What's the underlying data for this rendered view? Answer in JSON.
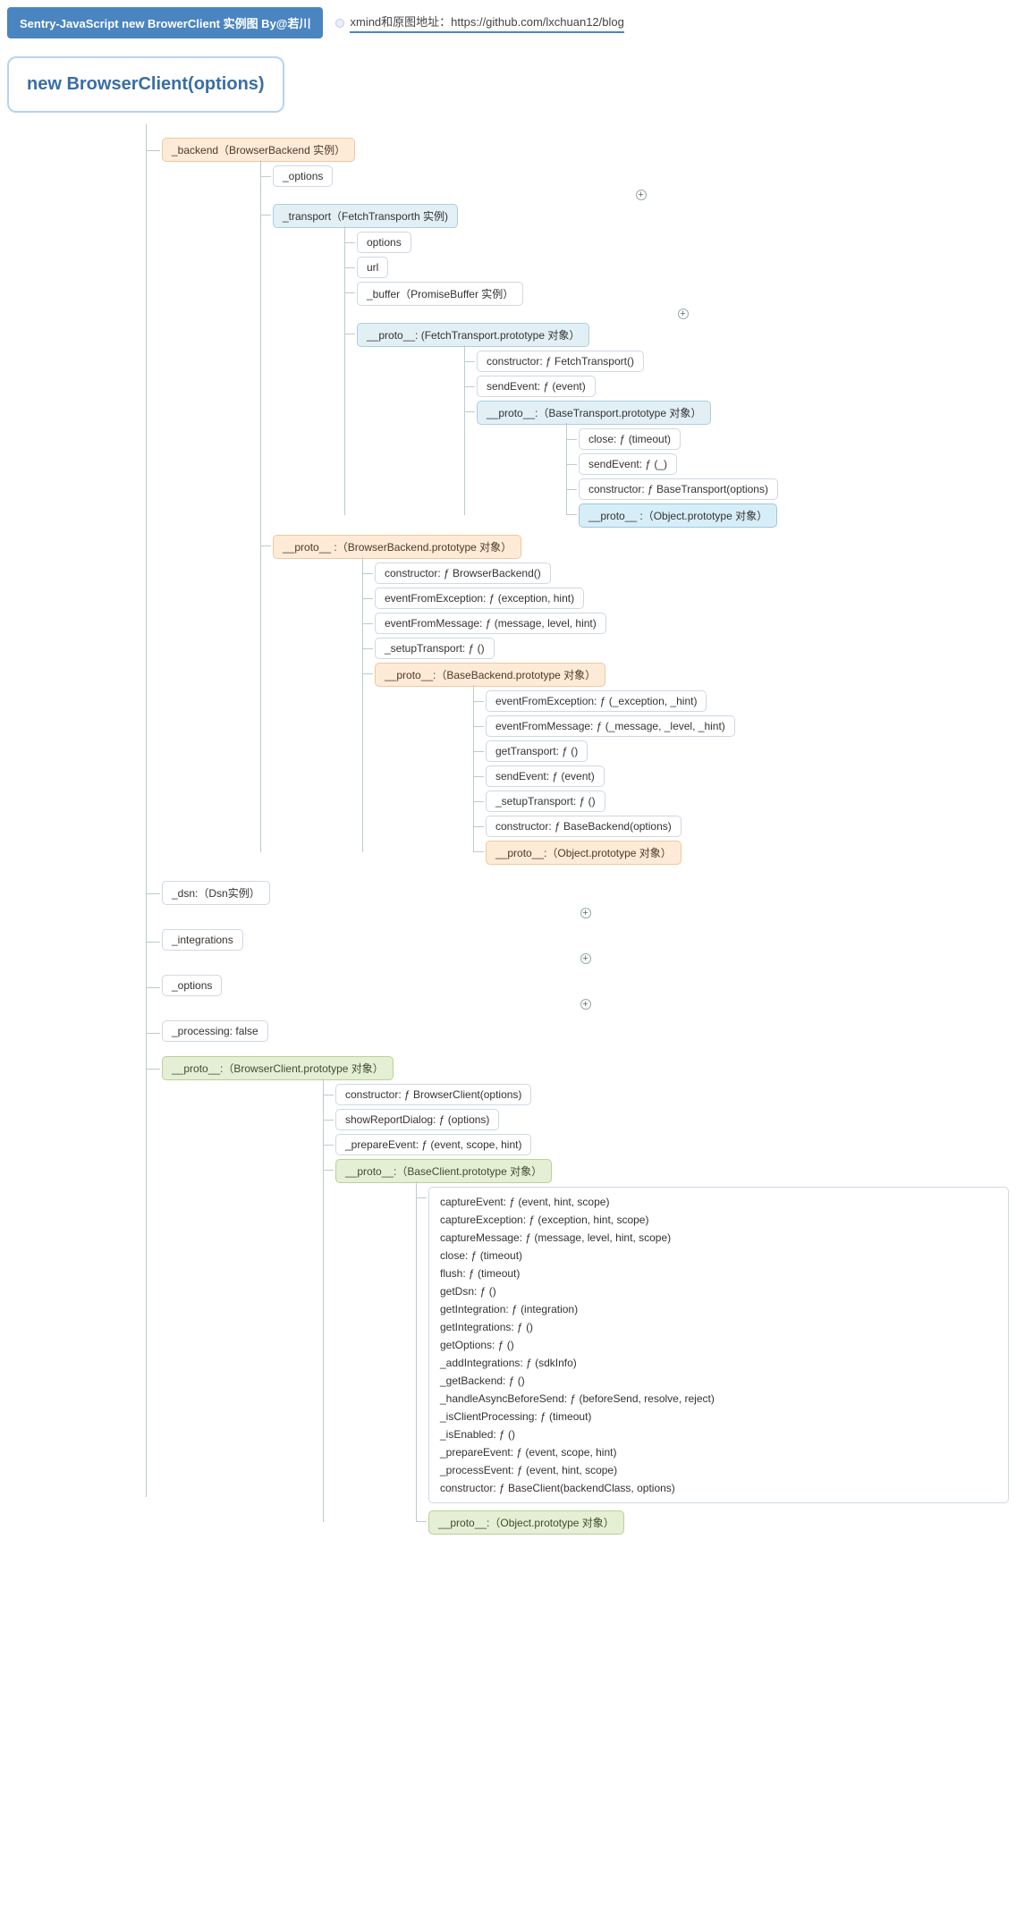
{
  "header": {
    "title": "Sentry-JavaScript new BrowerClient 实例图 By@若川",
    "url_label": "xmind和原图地址：https://github.com/lxchuan12/blog"
  },
  "root": "new BrowserClient(options)",
  "backend": {
    "label": "_backend（BrowserBackend 实例）",
    "options": "_options",
    "transport": {
      "label": "_transport（FetchTransporth 实例)",
      "options": "options",
      "url": "url",
      "buffer": "_buffer（PromiseBuffer 实例）",
      "proto": "__proto__: (FetchTransport.prototype 对象）",
      "fetch_proto": {
        "constructor": "constructor: ƒ FetchTransport()",
        "sendEvent": "sendEvent: ƒ (event)",
        "proto": "__proto__:（BaseTransport.prototype 对象）"
      },
      "base_proto": {
        "close": "close: ƒ (timeout)",
        "sendEvent": "sendEvent: ƒ (_)",
        "constructor": "constructor: ƒ BaseTransport(options)",
        "proto": "__proto__ :（Object.prototype 对象）"
      }
    },
    "proto": "__proto__ :（BrowserBackend.prototype 对象）",
    "browser_proto": {
      "constructor": "constructor: ƒ BrowserBackend()",
      "eventFromException": "eventFromException: ƒ (exception, hint)",
      "eventFromMessage": "eventFromMessage: ƒ (message, level, hint)",
      "setupTransport": "_setupTransport: ƒ ()",
      "proto": "__proto__:（BaseBackend.prototype 对象）"
    },
    "base_backend_proto": {
      "eventFromException": "eventFromException: ƒ (_exception, _hint)",
      "eventFromMessage": "eventFromMessage: ƒ (_message, _level, _hint)",
      "getTransport": "getTransport: ƒ ()",
      "sendEvent": "sendEvent: ƒ (event)",
      "setupTransport": "_setupTransport: ƒ ()",
      "constructor": "constructor: ƒ BaseBackend(options)",
      "proto": "__proto__:（Object.prototype 对象）"
    }
  },
  "dsn": "_dsn:（Dsn实例）",
  "integrations": "_integrations",
  "options": "_options",
  "processing": "_processing: false",
  "client_proto": {
    "label": "__proto__:（BrowserClient.prototype 对象）",
    "constructor": "constructor: ƒ BrowserClient(options)",
    "showReportDialog": "showReportDialog: ƒ (options)",
    "prepareEvent": "_prepareEvent: ƒ (event, scope, hint)",
    "proto": "__proto__:（BaseClient.prototype 对象）",
    "base_methods": [
      "captureEvent: ƒ (event, hint, scope)",
      "captureException: ƒ (exception, hint, scope)",
      "captureMessage: ƒ (message, level, hint, scope)",
      "close: ƒ (timeout)",
      "flush: ƒ (timeout)",
      "getDsn: ƒ ()",
      "getIntegration: ƒ (integration)",
      "getIntegrations: ƒ ()",
      "getOptions: ƒ ()",
      "_addIntegrations: ƒ (sdkInfo)",
      "_getBackend: ƒ ()",
      "_handleAsyncBeforeSend: ƒ (beforeSend, resolve, reject)",
      "_isClientProcessing: ƒ (timeout)",
      "_isEnabled: ƒ ()",
      "_prepareEvent: ƒ (event, scope, hint)",
      "_processEvent: ƒ (event, hint, scope)",
      "constructor: ƒ BaseClient(backendClass, options)"
    ],
    "object_proto": "__proto__:（Object.prototype 对象）"
  }
}
